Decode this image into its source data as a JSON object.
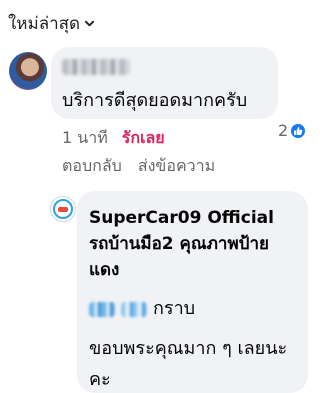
{
  "sort": {
    "label": "ใหม่ล่าสุด",
    "icon": "chevron-down-icon"
  },
  "comment": {
    "author_blurred": true,
    "text": "บริการดีสุดยอดมากครับ",
    "time": "1 นาที",
    "reaction_action": "รักเลย",
    "reaction_count": "2",
    "reaction_icon": "like-badge-icon",
    "reply_action": "ตอบกลับ",
    "message_action": "ส่งข้อความ"
  },
  "reply": {
    "author": "SuperCar09 Official รถบ้านมือ2 คุณภาพป้ายแดง",
    "greeting_suffix": "กราบ",
    "text": "ขอบพระคุณมาก ๆ เลยนะคะ"
  },
  "colors": {
    "bubble": "#f0f2f5",
    "love": "#e0245e",
    "meta": "#65676b",
    "like": "#1877f2"
  }
}
